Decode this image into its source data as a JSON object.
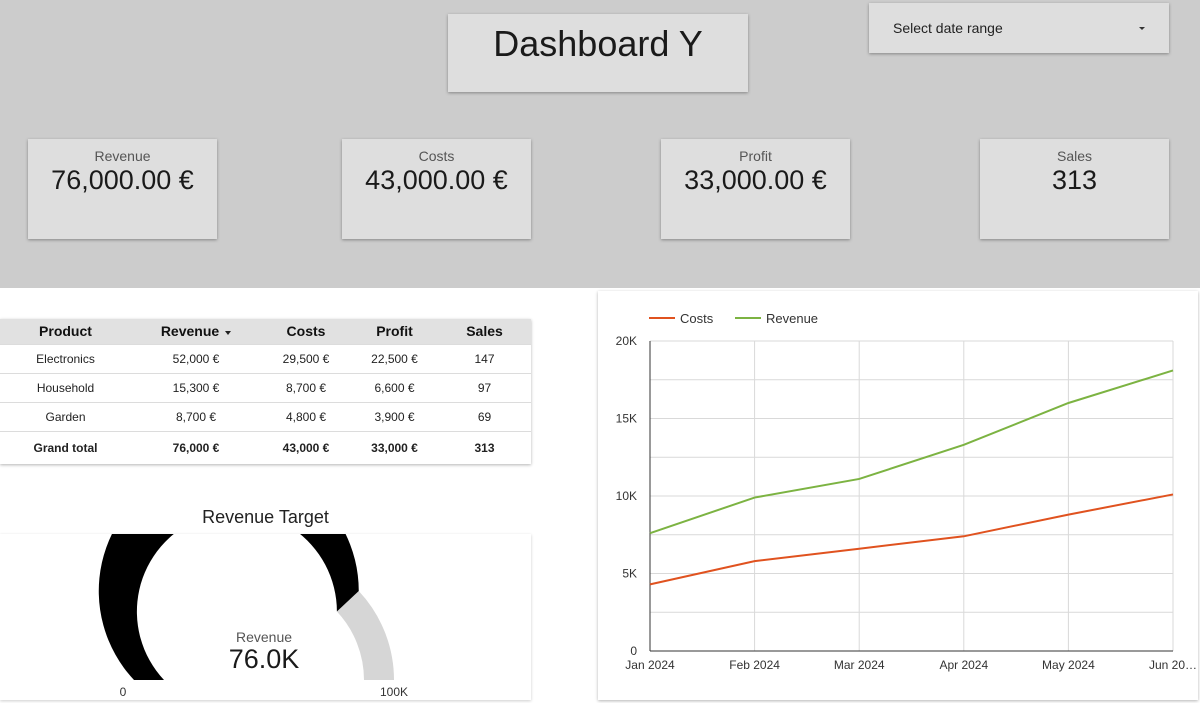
{
  "header": {
    "title": "Dashboard Y",
    "date_picker": {
      "label": "Select date range"
    }
  },
  "kpis": [
    {
      "label": "Revenue",
      "value": "76,000.00 €"
    },
    {
      "label": "Costs",
      "value": "43,000.00 €"
    },
    {
      "label": "Profit",
      "value": "33,000.00 €"
    },
    {
      "label": "Sales",
      "value": "313"
    }
  ],
  "table": {
    "columns": [
      "Product",
      "Revenue",
      "Costs",
      "Profit",
      "Sales"
    ],
    "rows": [
      [
        "Electronics",
        "52,000 €",
        "29,500 €",
        "22,500 €",
        "147"
      ],
      [
        "Household",
        "15,300 €",
        "8,700 €",
        "6,600 €",
        "97"
      ],
      [
        "Garden",
        "8,700 €",
        "4,800 €",
        "3,900 €",
        "69"
      ]
    ],
    "total": [
      "Grand total",
      "76,000 €",
      "43,000 €",
      "33,000 €",
      "313"
    ]
  },
  "gauge": {
    "title": "Revenue Target",
    "metric": "Revenue",
    "value_label": "76.0K",
    "value": 76000,
    "min": 0,
    "max": 100000,
    "min_label": "0",
    "max_label": "100K",
    "fill_color": "#000000",
    "track_color": "#d6d6d6"
  },
  "chart_data": {
    "type": "line",
    "categories": [
      "Jan 2024",
      "Feb 2024",
      "Mar 2024",
      "Apr 2024",
      "May 2024",
      "Jun 20…"
    ],
    "series": [
      {
        "name": "Costs",
        "color": "#e0521f",
        "values": [
          4300,
          5800,
          6600,
          7400,
          8800,
          10100
        ]
      },
      {
        "name": "Revenue",
        "color": "#7cb342",
        "values": [
          7600,
          9900,
          11100,
          13300,
          16000,
          18100
        ]
      }
    ],
    "y_ticks": [
      0,
      5000,
      10000,
      15000,
      20000
    ],
    "y_tick_labels": [
      "0",
      "5K",
      "10K",
      "15K",
      "20K"
    ],
    "ylim": [
      0,
      20000
    ],
    "grid": true,
    "legend": "top-left"
  }
}
